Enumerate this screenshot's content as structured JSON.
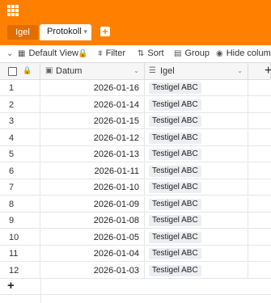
{
  "tabs": [
    "Igel",
    "Protokoll"
  ],
  "toolbar": {
    "view_label": "Default View",
    "filter_label": "Filter",
    "sort_label": "Sort",
    "group_label": "Group",
    "hide_label": "Hide columns"
  },
  "columns": {
    "date": "Datum",
    "igel": "Igel"
  },
  "rows": [
    {
      "idx": "1",
      "date": "2026-01-16",
      "igel": "Testigel ABC"
    },
    {
      "idx": "2",
      "date": "2026-01-14",
      "igel": "Testigel ABC"
    },
    {
      "idx": "3",
      "date": "2026-01-15",
      "igel": "Testigel ABC"
    },
    {
      "idx": "4",
      "date": "2026-01-12",
      "igel": "Testigel ABC"
    },
    {
      "idx": "5",
      "date": "2026-01-13",
      "igel": "Testigel ABC"
    },
    {
      "idx": "6",
      "date": "2026-01-11",
      "igel": "Testigel ABC"
    },
    {
      "idx": "7",
      "date": "2026-01-10",
      "igel": "Testigel ABC"
    },
    {
      "idx": "8",
      "date": "2026-01-09",
      "igel": "Testigel ABC"
    },
    {
      "idx": "9",
      "date": "2026-01-08",
      "igel": "Testigel ABC"
    },
    {
      "idx": "10",
      "date": "2026-01-05",
      "igel": "Testigel ABC"
    },
    {
      "idx": "11",
      "date": "2026-01-04",
      "igel": "Testigel ABC"
    },
    {
      "idx": "12",
      "date": "2026-01-03",
      "igel": "Testigel ABC"
    }
  ],
  "colors": {
    "accent": "#ff8000",
    "tag_bg": "#eceef2"
  },
  "icons": [
    "apps-grid-icon",
    "chevron-down-icon",
    "plus-icon",
    "lock-icon",
    "filter-icon",
    "sort-icon",
    "group-icon",
    "eye-icon",
    "calendar-icon",
    "list-icon"
  ]
}
